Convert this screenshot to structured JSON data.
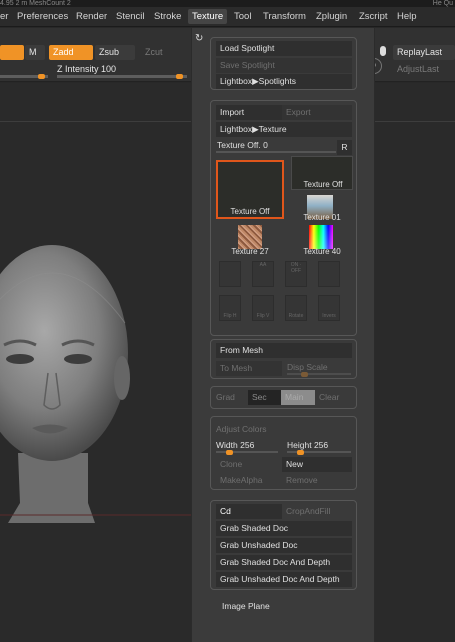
{
  "topstrip": {
    "left_text": "4.95 2 m   MeshCount 2",
    "right_text": "He   Qu"
  },
  "menubar": {
    "items": [
      "er",
      "Preferences",
      "Render",
      "Stencil",
      "Stroke",
      "Texture",
      "Tool",
      "Transform",
      "Zplugin",
      "Zscript",
      "Help"
    ]
  },
  "toolbar": {
    "m_label": "M",
    "zadd_label": "Zadd",
    "zsub_label": "Zsub",
    "zcut_label": "Zcut",
    "z_intensity_label": "Z Intensity",
    "z_intensity_value": "100",
    "replay_last": "ReplayLast",
    "adjust_last": "AdjustLast",
    "d_label": "D"
  },
  "panel": {
    "load_spotlight": "Load Spotlight",
    "save_spotlight": "Save Spotlight",
    "lightbox_spotlights": "Lightbox▶Spotlights",
    "import": "Import",
    "export": "Export",
    "lightbox_texture": "Lightbox▶Texture",
    "texture_off_slider": "Texture Off.",
    "texture_off_value": "0",
    "r_label": "R",
    "thumbnails": [
      {
        "label": "Texture Off",
        "selected": true
      },
      {
        "label": "Texture Off",
        "selected": false
      },
      {
        "label": "Texture 01",
        "selected": false
      },
      {
        "label": "Texture 27",
        "selected": false
      },
      {
        "label": "Texture 40",
        "selected": false
      }
    ],
    "icon_buttons_row1": [
      "",
      "AA",
      "ON · OFF",
      ""
    ],
    "icon_buttons_row2": [
      "Flip H",
      "Flip V",
      "Rotate",
      "Invers"
    ],
    "from_mesh": "From Mesh",
    "to_mesh": "To Mesh",
    "disp_scale": "Disp Scale",
    "grad": "Grad",
    "sec": "Sec",
    "main": "Main",
    "clear": "Clear",
    "adjust_colors": "Adjust Colors",
    "width_label": "Width",
    "width_value": "256",
    "height_label": "Height",
    "height_value": "256",
    "clone": "Clone",
    "new": "New",
    "make_alpha": "MakeAlpha",
    "remove": "Remove",
    "cd": "Cd",
    "crop_and_fill": "CropAndFill",
    "grab_shaded_doc": "Grab Shaded Doc",
    "grab_unshaded_doc": "Grab Unshaded Doc",
    "grab_shaded_doc_depth": "Grab Shaded Doc And Depth",
    "grab_unshaded_doc_depth": "Grab Unshaded Doc And Depth",
    "image_plane": "Image Plane"
  },
  "colors": {
    "accent": "#f09326",
    "highlight_border": "#e0561b",
    "panel_bg": "#3b3b3b"
  }
}
